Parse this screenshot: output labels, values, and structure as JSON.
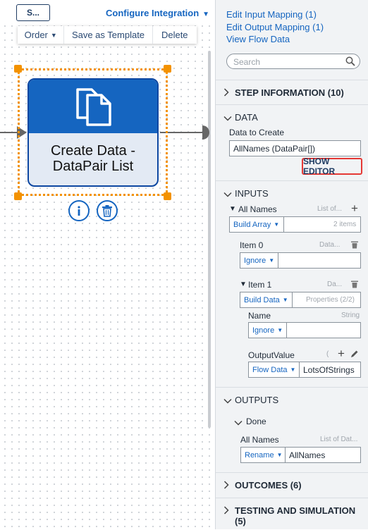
{
  "toolbar": {
    "step_button": "S...",
    "configure": "Configure Integration"
  },
  "menu": {
    "order": "Order",
    "save_template": "Save as Template",
    "delete": "Delete"
  },
  "node": {
    "title_line1": "Create Data -",
    "title_line2": "DataPair List"
  },
  "icons": {
    "node": "copy-documents-icon",
    "info": "info-icon",
    "delete": "trash-icon",
    "search": "search-icon"
  },
  "colors": {
    "accent": "#1565c0",
    "selection": "#f39200",
    "highlight": "#e53935"
  },
  "panel": {
    "links": [
      "Edit Input Mapping (1)",
      "Edit Output Mapping (1)",
      "View Flow Data"
    ],
    "search_placeholder": "Search",
    "step_information": "STEP INFORMATION (10)",
    "data": {
      "header": "DATA",
      "label": "Data to Create",
      "value": "AllNames (DataPair[])",
      "show_editor": "SHOW EDITOR"
    },
    "inputs": {
      "header": "INPUTS",
      "all_names": {
        "label": "All Names",
        "type": "List of...",
        "mode": "Build Array",
        "count": "2 items"
      },
      "item0": {
        "label": "Item 0",
        "type": "Data...",
        "mode": "Ignore"
      },
      "item1": {
        "label": "Item 1",
        "type": "Da...",
        "mode": "Build Data",
        "props": "Properties (2/2)",
        "name": {
          "label": "Name",
          "type": "String",
          "mode": "Ignore"
        },
        "output_value": {
          "label": "OutputValue",
          "type": "(",
          "mode": "Flow Data",
          "value": "LotsOfStrings"
        }
      }
    },
    "outputs": {
      "header": "OUTPUTS",
      "done": "Done",
      "all_names": {
        "label": "All Names",
        "type": "List of Dat...",
        "mode": "Rename",
        "value": "AllNames"
      }
    },
    "outcomes": "OUTCOMES (6)",
    "testing": "TESTING AND SIMULATION (5)"
  }
}
